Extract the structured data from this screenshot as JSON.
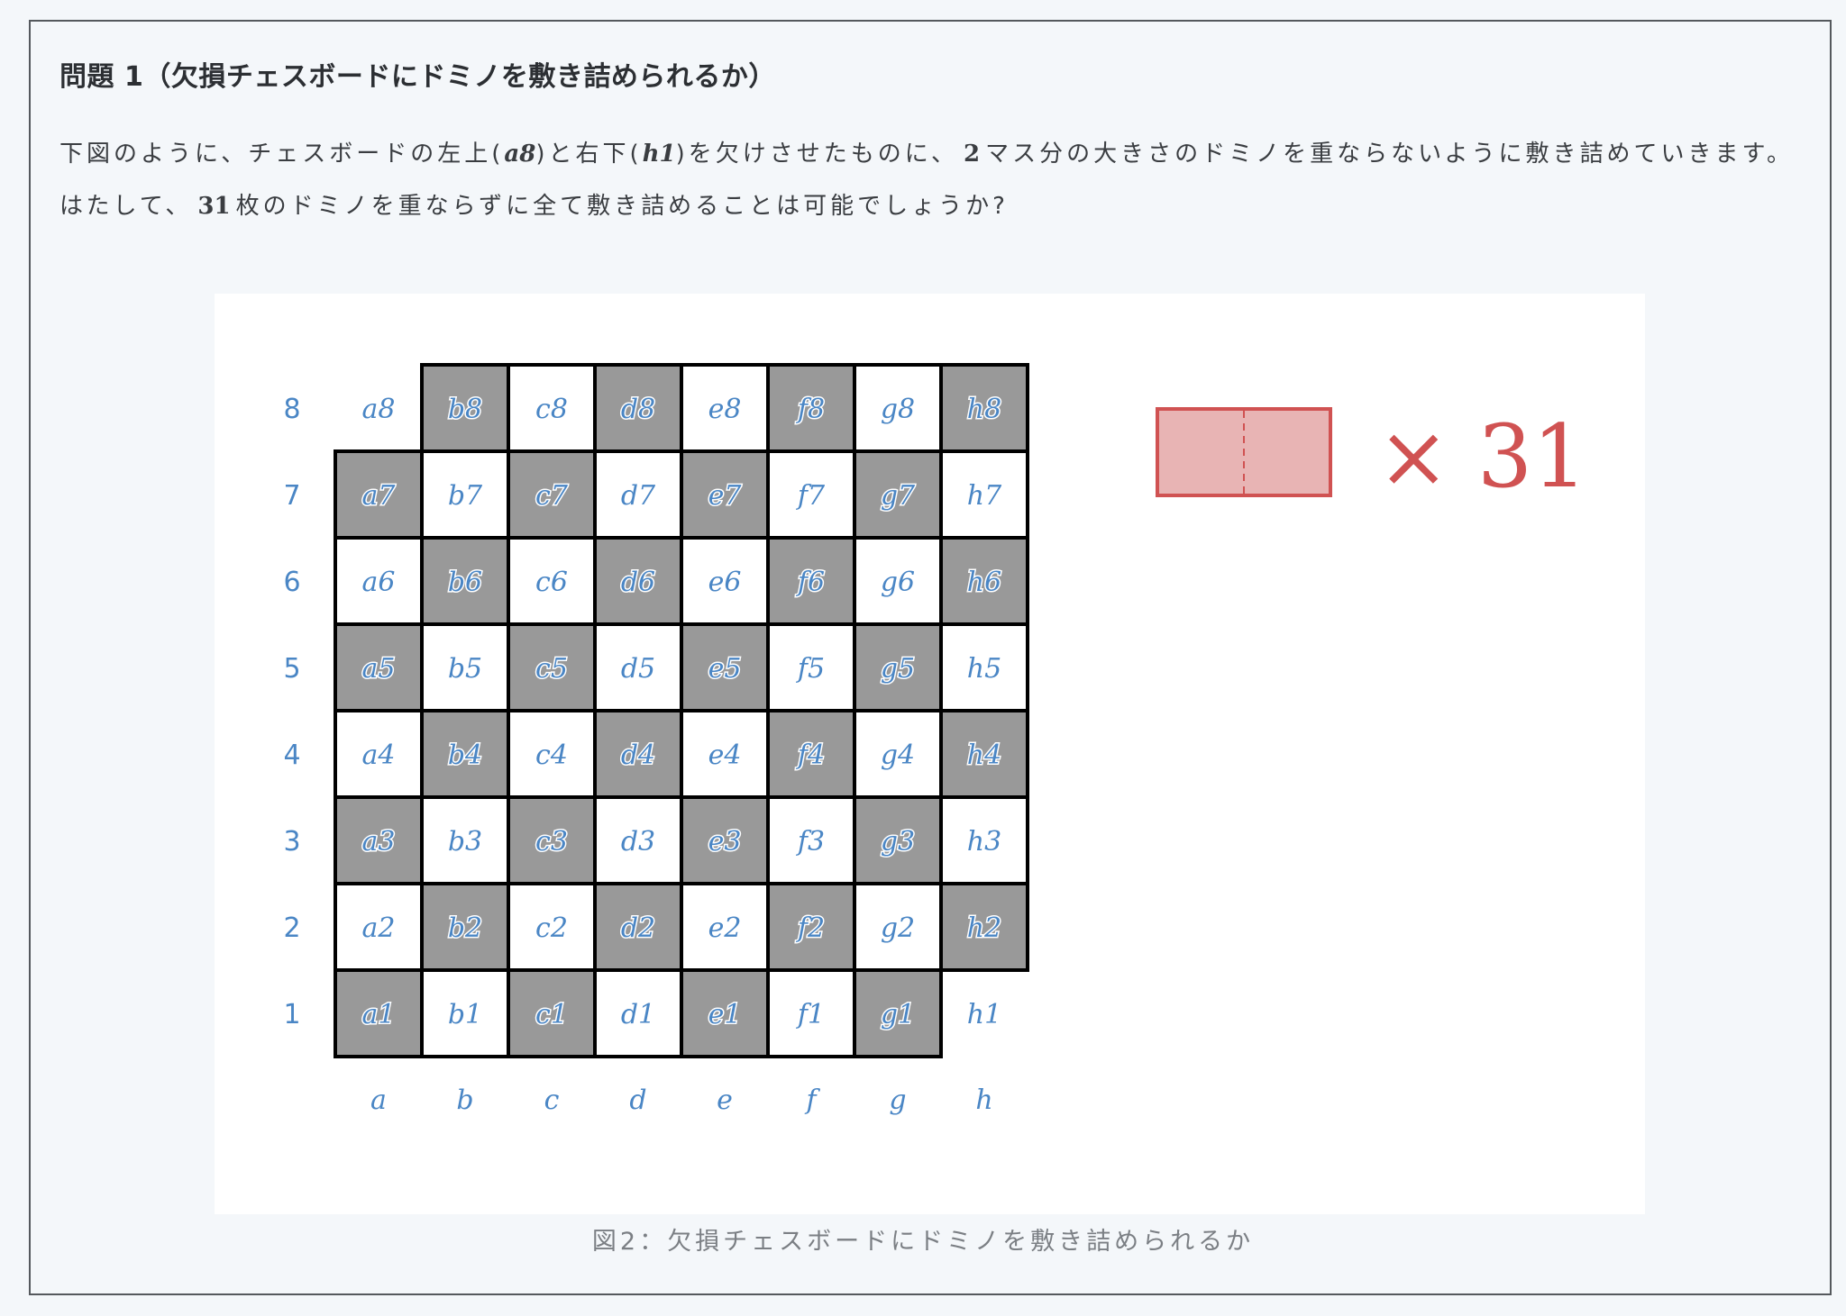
{
  "problem": {
    "title": "問題 1（欠損チェスボードにドミノを敷き詰められるか）",
    "body": {
      "p1": "下図のように、チェスボードの左上(",
      "m1": "a8",
      "p2": ")と右下(",
      "m2": "h1",
      "p3": ")を欠けさせたものに、",
      "n1": "2",
      "p4": "マス分の大きさのドミノを重ならないように敷き詰めていきます。はたして、",
      "n2": "31",
      "p5": "枚のドミノを重ならずに全て敷き詰めることは可能でしょうか?"
    }
  },
  "figure": {
    "caption": "図2：欠損チェスボードにドミノを敷き詰められるか",
    "board": {
      "files": [
        "a",
        "b",
        "c",
        "d",
        "e",
        "f",
        "g",
        "h"
      ],
      "ranks": [
        "8",
        "7",
        "6",
        "5",
        "4",
        "3",
        "2",
        "1"
      ],
      "removed_squares": [
        "a8",
        "h1"
      ],
      "dark_color": "#999999",
      "light_color": "#ffffff",
      "label_color": "#4a86c5"
    },
    "domino": {
      "count_label": "× 31",
      "count": 31,
      "fill_color": "#e8b4b4",
      "stroke_color": "#d05252"
    }
  }
}
